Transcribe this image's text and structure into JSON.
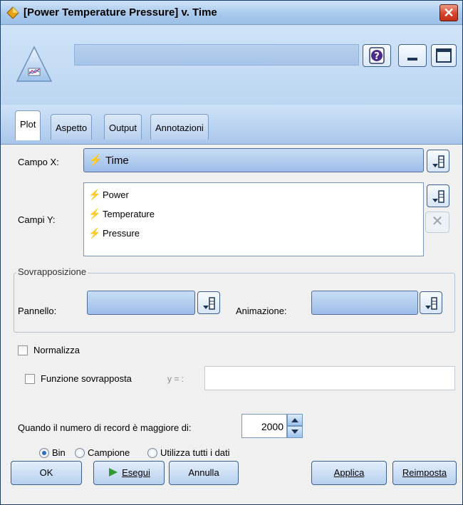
{
  "window": {
    "title": "[Power Temperature Pressure] v. Time"
  },
  "tabs": [
    {
      "label": "Plot",
      "active": true
    },
    {
      "label": "Aspetto",
      "active": false
    },
    {
      "label": "Output",
      "active": false
    },
    {
      "label": "Annotazioni",
      "active": false
    }
  ],
  "form": {
    "x_label": "Campo X:",
    "x_value": "Time",
    "y_label": "Campi Y:",
    "y_fields": [
      "Power",
      "Temperature",
      "Pressure"
    ],
    "overlay_group": "Sovrapposizione",
    "panel_label": "Pannello:",
    "animation_label": "Animazione:",
    "normalize_label": "Normalizza",
    "overlay_fn_label": "Funzione sovrapposta",
    "y_eq_label": "y = :",
    "records_label": "Quando il numero di record è maggiore di:",
    "records_value": "2000",
    "radio_bin": "Bin",
    "radio_sample": "Campione",
    "radio_all": "Utilizza tutti i dati"
  },
  "buttons": {
    "ok": "OK",
    "run": "Esegui",
    "cancel": "Annulla",
    "apply": "Applica",
    "reset": "Reimposta"
  },
  "colors": {
    "accent": "#2a6fbf",
    "field_bg": "#b1cdef",
    "title_gradient": "#a9c9ec"
  }
}
